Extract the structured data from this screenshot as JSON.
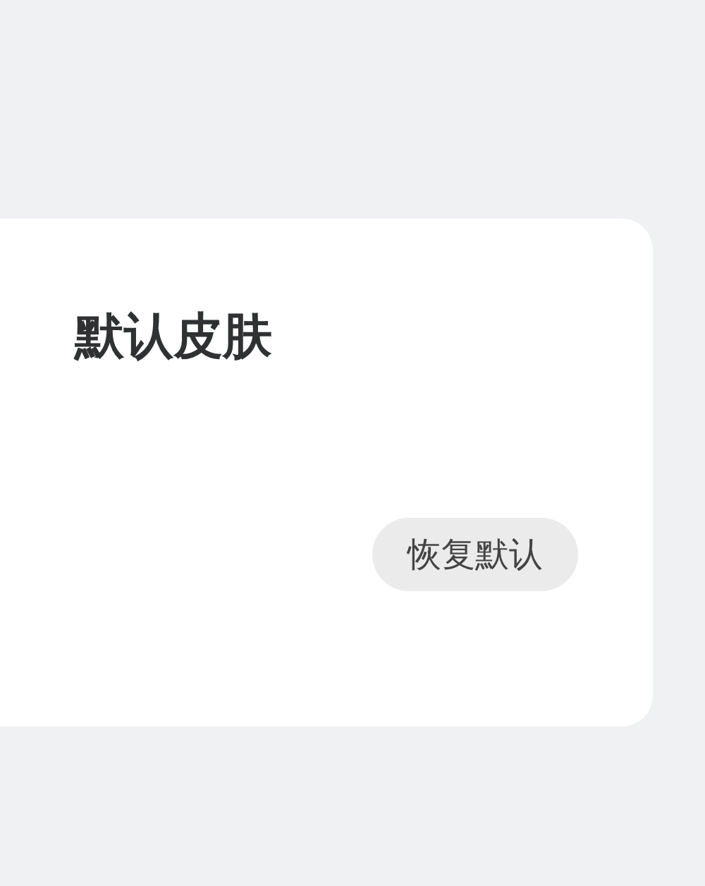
{
  "card": {
    "title": "默认皮肤",
    "button": "恢复默认"
  }
}
